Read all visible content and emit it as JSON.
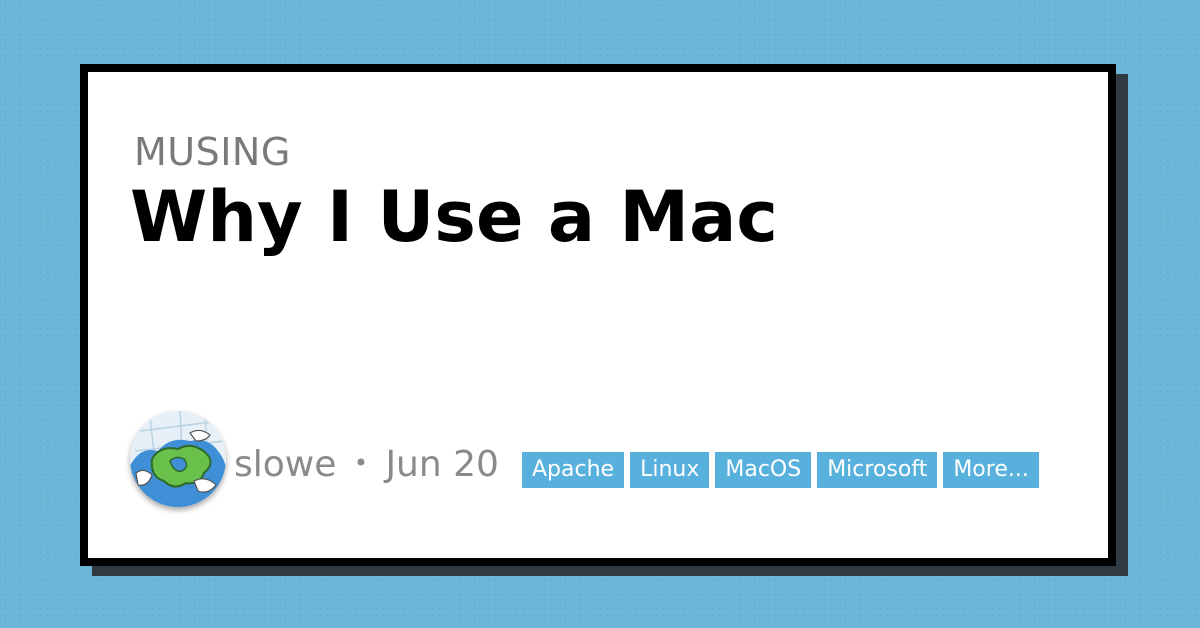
{
  "card": {
    "category": "MUSING",
    "title": "Why I Use a Mac"
  },
  "author": {
    "name": "slowe",
    "separator": "•",
    "date": "Jun 20",
    "avatar_icon": "globe-cartoon-avatar"
  },
  "tags": [
    "Apache",
    "Linux",
    "MacOS",
    "Microsoft",
    "More..."
  ],
  "colors": {
    "background": "#6cb6d8",
    "card": "#ffffff",
    "border": "#000000",
    "tag": "#58b1dd",
    "muted_text": "#8a8a8a"
  }
}
